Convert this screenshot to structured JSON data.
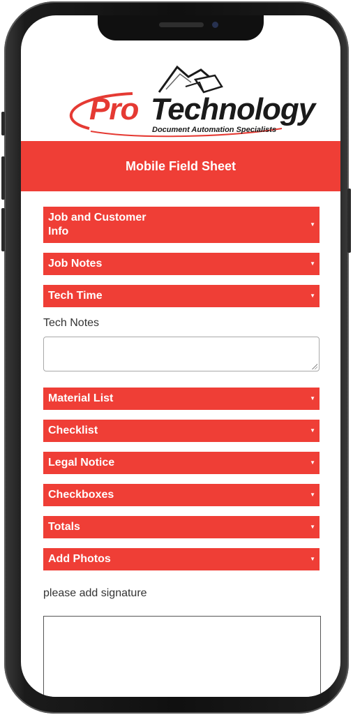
{
  "logo": {
    "brand_pro": "Pro",
    "brand_tech": "Technology",
    "tagline": "Document Automation Specialists"
  },
  "header": {
    "title": "Mobile Field Sheet"
  },
  "sections": [
    {
      "label": "Job and Customer Info",
      "icon": "caret-down"
    },
    {
      "label": "Job Notes",
      "icon": "caret-down"
    },
    {
      "label": "Tech Time",
      "icon": "caret-down"
    },
    {
      "label": "Material List",
      "icon": "caret-down"
    },
    {
      "label": "Checklist",
      "icon": "caret-down"
    },
    {
      "label": "Legal Notice",
      "icon": "caret-down"
    },
    {
      "label": "Checkboxes",
      "icon": "caret-down"
    },
    {
      "label": "Totals",
      "icon": "caret-down"
    },
    {
      "label": "Add Photos",
      "icon": "caret-down"
    }
  ],
  "tech_notes": {
    "label": "Tech Notes",
    "value": ""
  },
  "signature": {
    "label": "please add signature"
  },
  "colors": {
    "accent": "#ef3e36",
    "logo_red": "#e53a33",
    "logo_dark": "#1a1a1a"
  }
}
